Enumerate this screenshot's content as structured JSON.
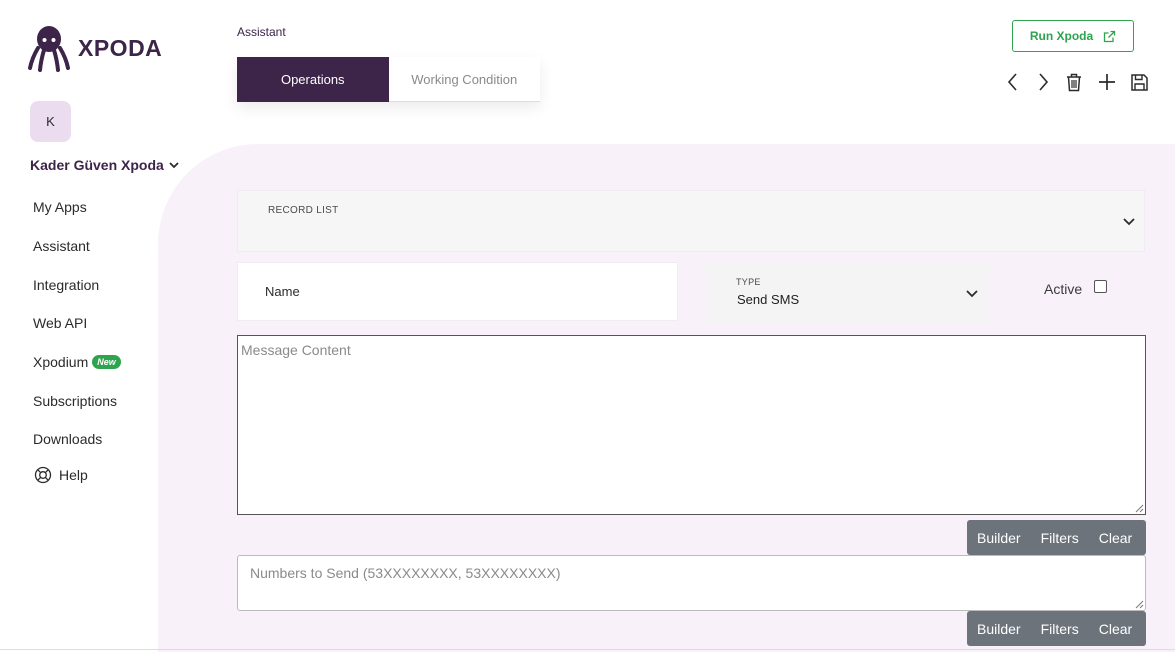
{
  "logo": {
    "text": "XPODA",
    "icon": "octopus-logo-icon",
    "color": "#3d2449"
  },
  "avatar": {
    "initial": "K"
  },
  "user": {
    "name": "Kader Güven Xpoda"
  },
  "nav": {
    "items": [
      {
        "label": "My Apps"
      },
      {
        "label": "Assistant"
      },
      {
        "label": "Integration"
      },
      {
        "label": "Web API"
      },
      {
        "label": "Xpodium",
        "badge": "New"
      },
      {
        "label": "Subscriptions"
      },
      {
        "label": "Downloads"
      }
    ],
    "help": "Help"
  },
  "header": {
    "breadcrumb": "Assistant",
    "tabs": [
      {
        "label": "Operations",
        "active": true
      },
      {
        "label": "Working Condition",
        "active": false
      }
    ],
    "run_button": "Run Xpoda"
  },
  "toolbar": {
    "icons": [
      "chevron-left-icon",
      "chevron-right-icon",
      "trash-icon",
      "plus-icon",
      "save-icon"
    ]
  },
  "form": {
    "record_list_label": "RECORD LIST",
    "name_placeholder": "Name",
    "type_label": "TYPE",
    "type_value": "Send SMS",
    "active_label": "Active",
    "active_checked": false,
    "message_placeholder": "Message Content",
    "numbers_placeholder": "Numbers to Send (53XXXXXXXX, 53XXXXXXXX)"
  },
  "actions": {
    "builder": "Builder",
    "filters": "Filters",
    "clear": "Clear"
  },
  "colors": {
    "accent": "#3d2449",
    "green": "#2ea44f",
    "panel": "#f8f1fa",
    "button_gray": "#6c737a"
  }
}
